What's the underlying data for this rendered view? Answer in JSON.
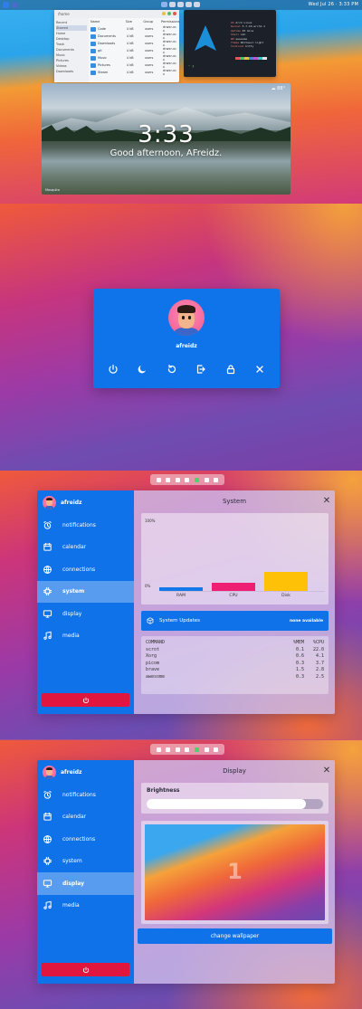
{
  "topbar": {
    "clock": "Wed Jul 26 · 3:33 PM"
  },
  "files_window": {
    "path": "/home",
    "headers": [
      "Name",
      "Size",
      "Group",
      "Permissions"
    ],
    "sidebar": [
      "Recent",
      "Starred",
      "Home",
      "Desktop",
      "Trash",
      "Documents",
      "Music",
      "Pictures",
      "Videos",
      "Downloads"
    ],
    "rows": [
      {
        "name": "Code",
        "size": "4 kB",
        "group": "users",
        "perm": "drwxr-xr-x"
      },
      {
        "name": "Documents",
        "size": "4 kB",
        "group": "users",
        "perm": "drwxr-xr-x"
      },
      {
        "name": "Downloads",
        "size": "4 kB",
        "group": "users",
        "perm": "drwxr-xr-x"
      },
      {
        "name": "git",
        "size": "4 kB",
        "group": "users",
        "perm": "drwxr-xr-x"
      },
      {
        "name": "Music",
        "size": "4 kB",
        "group": "users",
        "perm": "drwxr-xr-x"
      },
      {
        "name": "Pictures",
        "size": "4 kB",
        "group": "users",
        "perm": "drwxr-xr-x"
      },
      {
        "name": "Steam",
        "size": "4 kB",
        "group": "users",
        "perm": "drwxr-xr-x"
      }
    ]
  },
  "terminal": {
    "info": [
      {
        "k": "OS",
        "v": "Arch Linux"
      },
      {
        "k": "Kernel",
        "v": "5.7.10-arch1-1"
      },
      {
        "k": "Uptime",
        "v": "45 mins"
      },
      {
        "k": "Shell",
        "v": "zsh"
      },
      {
        "k": "WM",
        "v": "awesome"
      },
      {
        "k": "Theme",
        "v": "Whitesur-light"
      },
      {
        "k": "Terminal",
        "v": "kitty"
      }
    ],
    "prompt": "~ ❯",
    "palette": [
      "#1c2028",
      "#e05555",
      "#48c16b",
      "#e3c04a",
      "#3b8de0",
      "#b35bd6",
      "#3bc6c6",
      "#e6e6e6"
    ]
  },
  "lockscreen": {
    "time": "3:33",
    "greeting": "Good afternoon, AFreidz.",
    "weather": "☁ 88°",
    "corner": "Mosquito"
  },
  "exit_screen": {
    "username": "afreidz",
    "actions": [
      {
        "name": "power-icon",
        "label": "Poweroff"
      },
      {
        "name": "moon-icon",
        "label": "Suspend"
      },
      {
        "name": "restart-icon",
        "label": "Reboot"
      },
      {
        "name": "logout-icon",
        "label": "Logout"
      },
      {
        "name": "lock-icon",
        "label": "Lock"
      },
      {
        "name": "close-icon",
        "label": "Close"
      }
    ]
  },
  "panel": {
    "username": "afreidz",
    "nav": [
      "notifications",
      "calendar",
      "connections",
      "system",
      "display",
      "media"
    ],
    "nav_icons": [
      "alarm-clock-icon",
      "calendar-icon",
      "globe-icon",
      "chip-icon",
      "monitor-icon",
      "music-note-icon"
    ]
  },
  "system": {
    "title": "System",
    "y_top": "100%",
    "y_bottom": "0%",
    "updates_label": "System Updates",
    "updates_status": "none available",
    "proc_headers": [
      "COMMAND",
      "%MEM",
      "%CPU"
    ],
    "procs": [
      {
        "cmd": "scrot",
        "mem": "0.1",
        "cpu": "22.0"
      },
      {
        "cmd": "Xorg",
        "mem": "0.6",
        "cpu": "4.1"
      },
      {
        "cmd": "picom",
        "mem": "0.3",
        "cpu": "3.7"
      },
      {
        "cmd": "brave",
        "mem": "1.5",
        "cpu": "2.8"
      },
      {
        "cmd": "awesome",
        "mem": "0.3",
        "cpu": "2.5"
      }
    ]
  },
  "display": {
    "title": "Display",
    "brightness_label": "Brightness",
    "brightness": 0.9,
    "screen_number": "1",
    "change_wallpaper": "change wallpaper"
  },
  "chart_data": {
    "type": "bar",
    "categories": [
      "RAM",
      "CPU",
      "Disk"
    ],
    "values": [
      5,
      12,
      27
    ],
    "colors": [
      "#1479e8",
      "#ee1f73",
      "#ffc107"
    ],
    "ylim": [
      0,
      100
    ],
    "ytick_labels": [
      "100%",
      "0%"
    ]
  },
  "colors": {
    "accent": "#0f72e8",
    "danger": "#e0163e"
  }
}
